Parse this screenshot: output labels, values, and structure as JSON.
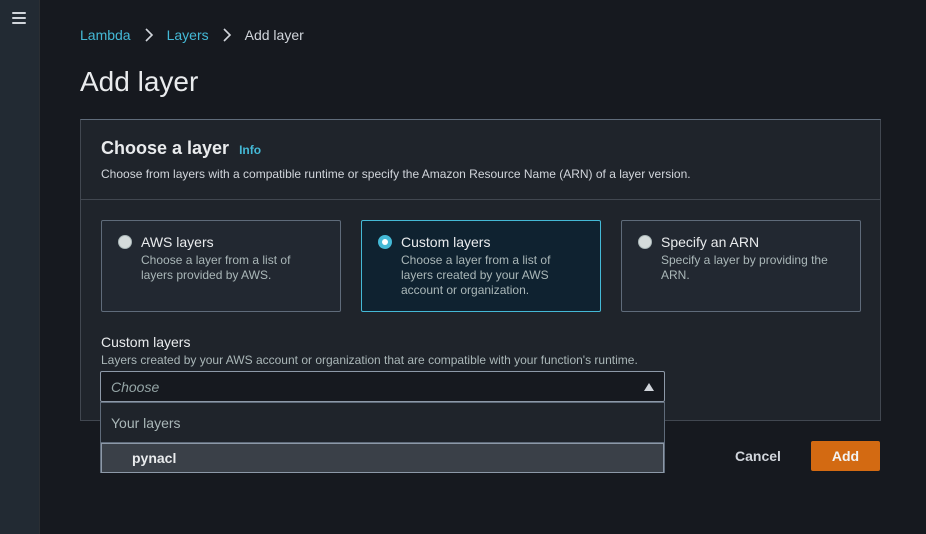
{
  "breadcrumb": {
    "items": [
      "Lambda",
      "Layers"
    ],
    "current": "Add layer"
  },
  "page": {
    "title": "Add layer"
  },
  "panel": {
    "title": "Choose a layer",
    "info": "Info",
    "description": "Choose from layers with a compatible runtime or specify the Amazon Resource Name (ARN) of a layer version."
  },
  "tiles": [
    {
      "label": "AWS layers",
      "description": "Choose a layer from a list of layers provided by AWS.",
      "selected": false
    },
    {
      "label": "Custom layers",
      "description": "Choose a layer from a list of layers created by your AWS account or organization.",
      "selected": true
    },
    {
      "label": "Specify an ARN",
      "description": "Specify a layer by providing the ARN.",
      "selected": false
    }
  ],
  "field": {
    "label": "Custom layers",
    "description": "Layers created by your AWS account or organization that are compatible with your function's runtime.",
    "placeholder": "Choose"
  },
  "dropdown": {
    "group": "Your layers",
    "options": [
      "pynacl"
    ]
  },
  "actions": {
    "cancel": "Cancel",
    "add": "Add"
  },
  "colors": {
    "accent": "#44b9d6",
    "primary_button": "#d36a12",
    "background": "#16191f"
  }
}
